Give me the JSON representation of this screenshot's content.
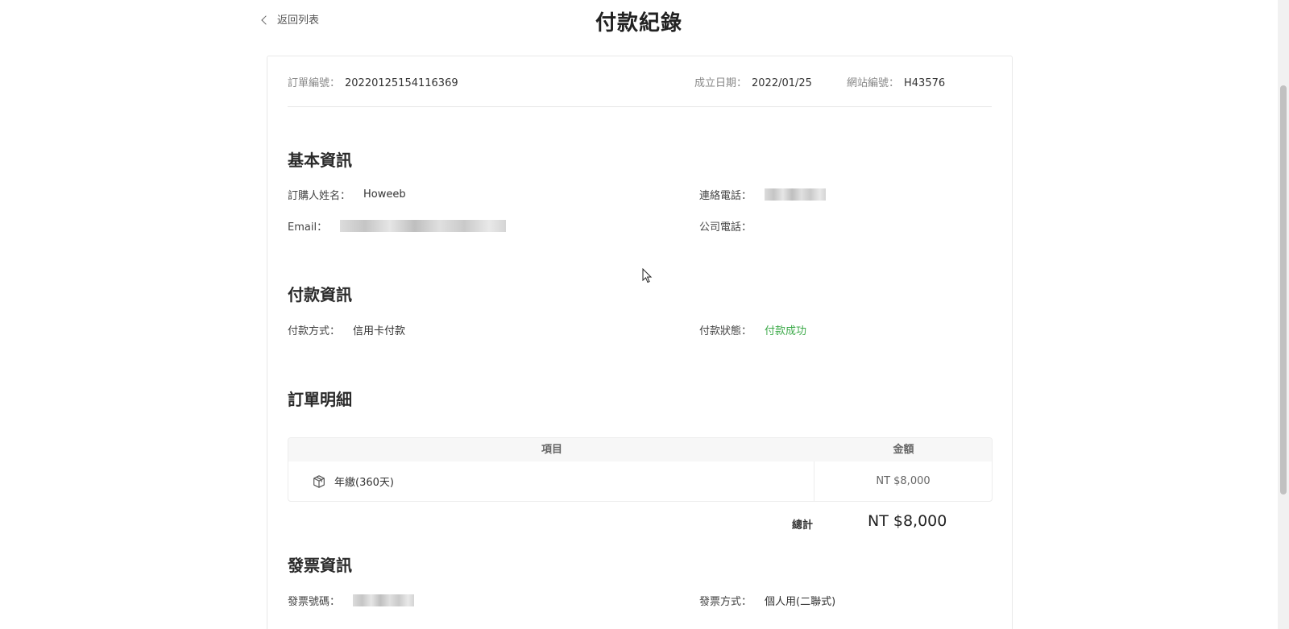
{
  "header": {
    "back_label": "返回列表",
    "title": "付款紀錄"
  },
  "meta": {
    "order_no_label": "訂單編號：",
    "order_no": "20220125154116369",
    "created_label": "成立日期：",
    "created": "2022/01/25",
    "site_label": "網站編號：",
    "site": "H43576"
  },
  "basic": {
    "title": "基本資訊",
    "name_label": "訂購人姓名：",
    "name": "Howeeb",
    "phone_label": "連絡電話：",
    "email_label": "Email：",
    "company_phone_label": "公司電話："
  },
  "payment": {
    "title": "付款資訊",
    "method_label": "付款方式：",
    "method": "信用卡付款",
    "status_label": "付款狀態：",
    "status": "付款成功",
    "status_color": "#3daa4a"
  },
  "details": {
    "title": "訂單明細",
    "col_item": "項目",
    "col_amount": "金額",
    "rows": [
      {
        "item": "年繳(360天)",
        "amount": "NT $8,000",
        "icon": "package-icon"
      }
    ],
    "total_label": "總計",
    "total": "NT $8,000"
  },
  "invoice": {
    "title": "發票資訊",
    "number_label": "發票號碼：",
    "method_label": "發票方式：",
    "method": "個人用(二聯式)"
  }
}
